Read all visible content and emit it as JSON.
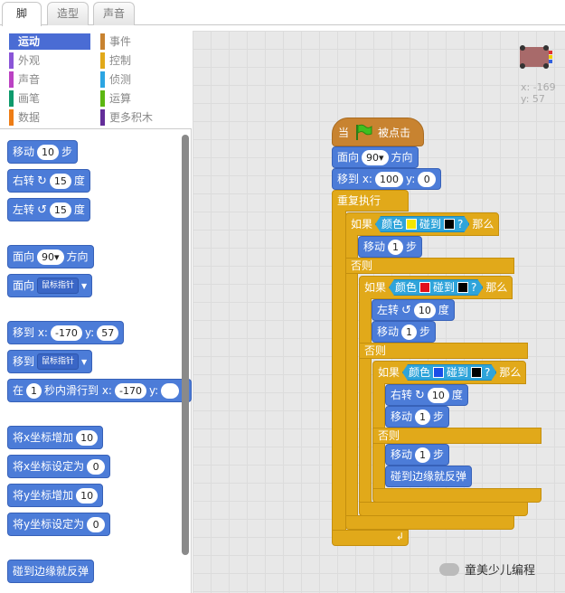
{
  "tabs": [
    "脚本",
    "造型",
    "声音"
  ],
  "categories": [
    {
      "label": "运动",
      "color": "#4a6cd4",
      "active": true
    },
    {
      "label": "外观",
      "color": "#8a55d7"
    },
    {
      "label": "声音",
      "color": "#bb42c3"
    },
    {
      "label": "画笔",
      "color": "#0e9a6c"
    },
    {
      "label": "数据",
      "color": "#ee7d16"
    },
    {
      "label": "事件",
      "color": "#c88330"
    },
    {
      "label": "控制",
      "color": "#e1a91a"
    },
    {
      "label": "侦测",
      "color": "#2ca5e2"
    },
    {
      "label": "运算",
      "color": "#5cb712"
    },
    {
      "label": "更多积木",
      "color": "#632d99"
    }
  ],
  "palette": {
    "move": {
      "label": "移动",
      "value": "10",
      "suffix": "步"
    },
    "turn_right": {
      "label": "右转",
      "icon": "↻",
      "value": "15",
      "suffix": "度"
    },
    "turn_left": {
      "label": "左转",
      "icon": "↺",
      "value": "15",
      "suffix": "度"
    },
    "point_dir": {
      "label": "面向",
      "value": "90▾",
      "suffix": "方向"
    },
    "point_towards": {
      "label": "面向",
      "dropdown": "鼠标指针"
    },
    "goto_xy": {
      "label": "移到 x:",
      "x": "-170",
      "ylabel": "y:",
      "y": "57"
    },
    "goto": {
      "label": "移到",
      "dropdown": "鼠标指针"
    },
    "glide": {
      "label": "在",
      "secs": "1",
      "mid": "秒内滑行到 x:",
      "x": "-170",
      "ylabel": "y:"
    },
    "change_x": {
      "label": "将x坐标增加",
      "value": "10"
    },
    "set_x": {
      "label": "将x坐标设定为",
      "value": "0"
    },
    "change_y": {
      "label": "将y坐标增加",
      "value": "10"
    },
    "set_y": {
      "label": "将y坐标设定为",
      "value": "0"
    },
    "bounce": {
      "label": "碰到边缘就反弹"
    }
  },
  "stage": {
    "x_label": "x: -169",
    "y_label": "y: 57"
  },
  "script": {
    "hat": {
      "pre": "当",
      "post": "被点击"
    },
    "point": {
      "label": "面向",
      "value": "90▾",
      "suffix": "方向"
    },
    "goto": {
      "label": "移到 x:",
      "x": "100",
      "ylabel": "y:",
      "y": "0"
    },
    "forever": "重复执行",
    "if1": {
      "pre": "如果",
      "color_lbl": "颜色",
      "touch": "碰到",
      "q": "?",
      "then": "那么",
      "c1": "#f5e600",
      "c2": "#000000"
    },
    "move1": {
      "label": "移动",
      "value": "1",
      "suffix": "步"
    },
    "else1": "否则",
    "if2": {
      "pre": "如果",
      "color_lbl": "颜色",
      "touch": "碰到",
      "q": "?",
      "then": "那么",
      "c1": "#e0101a",
      "c2": "#000000"
    },
    "left": {
      "label": "左转",
      "icon": "↺",
      "value": "10",
      "suffix": "度"
    },
    "move2": {
      "label": "移动",
      "value": "1",
      "suffix": "步"
    },
    "else2": "否则",
    "if3": {
      "pre": "如果",
      "color_lbl": "颜色",
      "touch": "碰到",
      "q": "?",
      "then": "那么",
      "c1": "#1a4de8",
      "c2": "#000000"
    },
    "right": {
      "label": "右转",
      "icon": "↻",
      "value": "10",
      "suffix": "度"
    },
    "move3": {
      "label": "移动",
      "value": "1",
      "suffix": "步"
    },
    "else3": "否则",
    "move4": {
      "label": "移动",
      "value": "1",
      "suffix": "步"
    },
    "bounce": "碰到边缘就反弹",
    "loop_arrow": "↲"
  },
  "watermark": "童美少儿编程"
}
